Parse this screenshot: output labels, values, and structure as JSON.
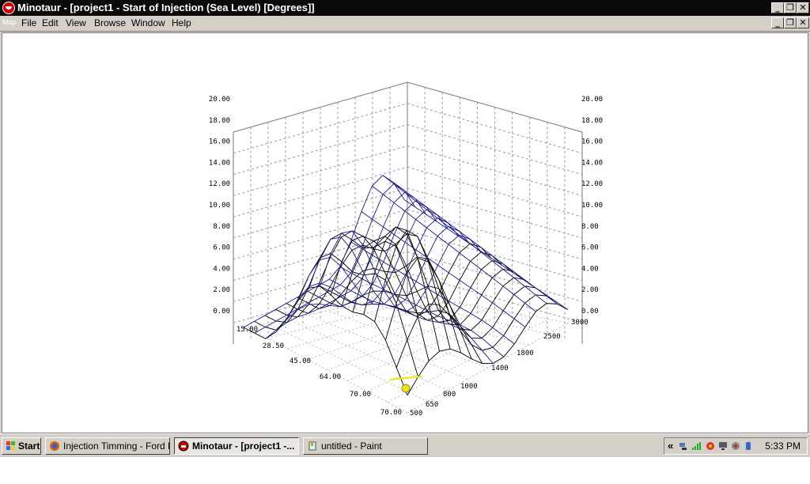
{
  "window": {
    "title": "Minotaur - [project1 - Start of Injection (Sea Level) [Degrees]]",
    "controls": {
      "minimize": "_",
      "restore": "❐",
      "close": "✕"
    }
  },
  "menubar": {
    "map_icon_label": "Map",
    "items": [
      {
        "label": "File"
      },
      {
        "label": "Edit"
      },
      {
        "label": "View"
      },
      {
        "label": "Browse"
      },
      {
        "label": "Window"
      },
      {
        "label": "Help"
      }
    ]
  },
  "chart_data": {
    "type": "surface",
    "z_axis": {
      "min": 0,
      "max": 20,
      "ticks": [
        "20.00",
        "18.00",
        "16.00",
        "14.00",
        "12.00",
        "10.00",
        "8.00",
        "6.00",
        "4.00",
        "2.00",
        "0.00"
      ]
    },
    "left_axis": {
      "ticks": [
        "15.00",
        "28.50",
        "45.00",
        "64.00",
        "70.00",
        "70.00"
      ]
    },
    "right_axis": {
      "ticks": [
        "500",
        "650",
        "800",
        "1000",
        "1400",
        "1800",
        "2500",
        "3000"
      ]
    },
    "grid": true,
    "colors": {
      "front_mesh": "#1a1a8c",
      "back_mesh": "#000000",
      "grid": "#9a9a9a",
      "cursor": "#f5e400"
    }
  },
  "taskbar": {
    "start_label": "Start",
    "buttons": [
      {
        "label": "Injection Timming - Ford D...",
        "active": false,
        "icon": "firefox-icon"
      },
      {
        "label": "Minotaur - [project1 -...",
        "active": true,
        "icon": "minotaur-icon"
      },
      {
        "label": "untitled - Paint",
        "active": false,
        "icon": "paint-icon"
      }
    ],
    "tray": {
      "chevron": "«",
      "clock": "5:33 PM"
    }
  }
}
